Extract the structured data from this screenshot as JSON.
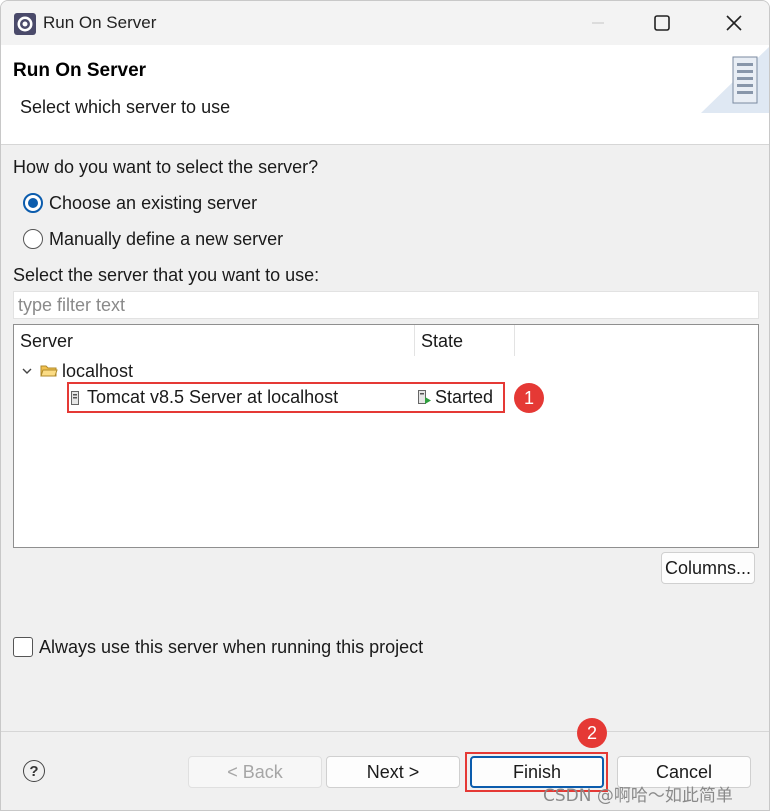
{
  "window": {
    "title": "Run On Server",
    "controls": {
      "minimize": "minimize-icon",
      "maximize": "maximize-icon",
      "close": "close-icon"
    }
  },
  "banner": {
    "title": "Run On Server",
    "subtitle": "Select which server to use",
    "graphic": "server-tower-icon"
  },
  "selection": {
    "question": "How do you want to select the server?",
    "options": [
      {
        "label": "Choose an existing server",
        "checked": true
      },
      {
        "label": "Manually define a new server",
        "checked": false
      }
    ]
  },
  "server_list": {
    "label": "Select the server that you want to use:",
    "filter_placeholder": "type filter text",
    "filter_value": "",
    "columns": [
      "Server",
      "State"
    ],
    "host": {
      "name": "localhost",
      "expanded": true
    },
    "servers": [
      {
        "name": "Tomcat v8.5 Server at localhost",
        "state": "Started"
      }
    ],
    "columns_button": "Columns..."
  },
  "always_use": {
    "label": "Always use this server when running this project",
    "checked": false
  },
  "annotations": {
    "badge1": "1",
    "badge2": "2",
    "highlight_color": "#e53935"
  },
  "footer": {
    "help": "?",
    "back": "< Back",
    "next": "Next >",
    "finish": "Finish",
    "cancel": "Cancel"
  },
  "watermark": "CSDN @啊哈～如此简单",
  "colors": {
    "accent": "#0b5cad",
    "annotation": "#e53935"
  }
}
